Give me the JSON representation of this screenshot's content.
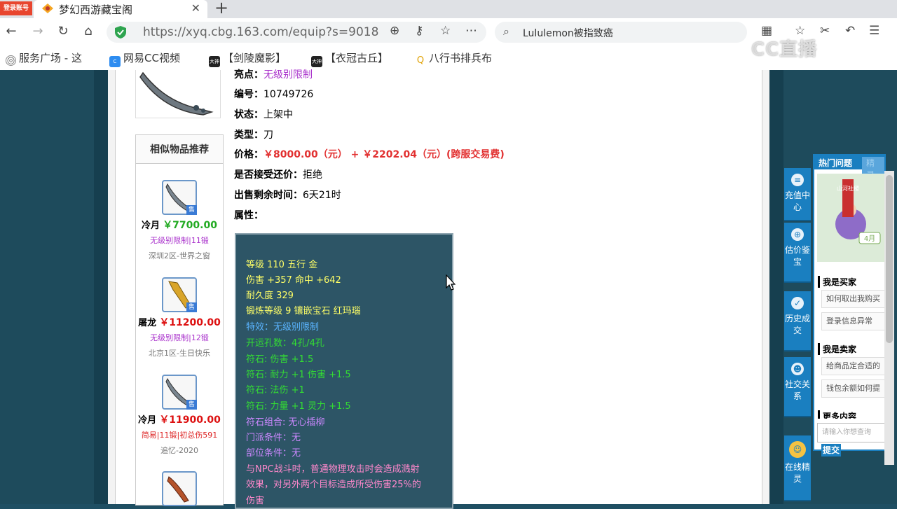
{
  "browser": {
    "login_badge": "登录账号",
    "tab_title": "梦幻西游藏宝阁",
    "tab_close": "✕",
    "new_tab": "+",
    "url": "https://xyq.cbg.163.com/equip?s=9018",
    "search_text": "Lululemon被指致癌",
    "bookmarks": [
      "服务广场 - 这",
      "网易CC视频",
      "【剑陵魔影】",
      "【衣冠古丘】",
      "八行书排兵布"
    ],
    "bookmark_badge": "大神",
    "watermark": "CC直播"
  },
  "item": {
    "highlight_label": "亮点：",
    "highlight_value": "无级别限制",
    "id_label": "编号：",
    "id_value": "10749726",
    "status_label": "状态：",
    "status_value": "上架中",
    "type_label": "类型：",
    "type_value": "刀",
    "price_label": "价格：",
    "price_value": "￥8000.00（元） +  ￥2202.04（元）(跨服交易费)",
    "bargain_label": "是否接受还价：",
    "bargain_value": "拒绝",
    "time_label": "出售剩余时间：",
    "time_value": "6天21时",
    "attr_label": "属性："
  },
  "attributes": [
    {
      "text": "等级 110 五行 金",
      "color": "#ffff66"
    },
    {
      "text": "伤害 +357 命中 +642",
      "color": "#ffff66"
    },
    {
      "text": "耐久度 329",
      "color": "#ffff66"
    },
    {
      "text": "锻炼等级 9 镶嵌宝石 红玛瑙",
      "color": "#ffff66"
    },
    {
      "text": "特效：无级别限制",
      "color": "#5ab4ff"
    },
    {
      "text": "开运孔数：4孔/4孔",
      "color": "#33dd33"
    },
    {
      "text": "符石: 伤害 +1.5",
      "color": "#33dd33"
    },
    {
      "text": "符石: 耐力 +1 伤害 +1.5",
      "color": "#33dd33"
    },
    {
      "text": "符石: 法伤 +1",
      "color": "#33dd33"
    },
    {
      "text": "符石: 力量 +1 灵力 +1.5",
      "color": "#33dd33"
    },
    {
      "text": "符石组合: 无心插柳",
      "color": "#cc88ff"
    },
    {
      "text": "门派条件：无",
      "color": "#cc88ff"
    },
    {
      "text": "部位条件：无",
      "color": "#cc88ff"
    },
    {
      "text": "与NPC战斗时，普通物理攻击时会造成溅射",
      "color": "#ff88cc"
    },
    {
      "text": "效果，对另外两个目标造成所受伤害25%的",
      "color": "#ff88cc"
    },
    {
      "text": "伤害",
      "color": "#ff88cc"
    }
  ],
  "similar": {
    "title": "相似物品推荐",
    "sale_tag": "售",
    "items": [
      {
        "name": "冷月",
        "price": "￥7700.00",
        "price_color": "#22aa22",
        "attr": "无级别限制|11锻",
        "attr_color": "#aa33cc",
        "server": "深圳2区-世界之窗"
      },
      {
        "name": "屠龙",
        "price": "￥11200.00",
        "price_color": "#dd1111",
        "attr": "无级别限制|12锻",
        "attr_color": "#aa33cc",
        "server": "北京1区-生日快乐"
      },
      {
        "name": "冷月",
        "price": "￥11900.00",
        "price_color": "#dd1111",
        "attr": "简易|11锻|初总伤591",
        "attr_color": "#dd2222",
        "server": "追忆-2020"
      }
    ]
  },
  "help": {
    "nav": [
      "充值中心",
      "估价鉴宝",
      "历史成交",
      "社交关系",
      "在线精灵"
    ],
    "tab_hot": "热门问题",
    "tab_other": "精灵",
    "banner_text": "山河社稷",
    "banner_month": "4月",
    "buyer_title": "我是买家",
    "buyer_links": [
      "如何取出我购买",
      "登录信息异常"
    ],
    "seller_title": "我是卖家",
    "seller_links": [
      "给商品定合适的",
      "钱包余额如何提"
    ],
    "more_title": "更多内容",
    "input_placeholder": "请输入你想查询",
    "submit": "提交"
  }
}
